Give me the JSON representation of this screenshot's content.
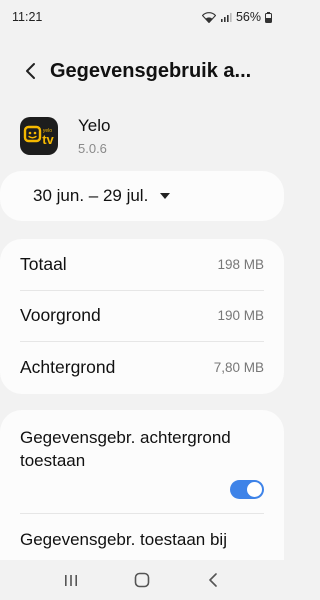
{
  "status": {
    "time": "11:21",
    "battery": "56%"
  },
  "header": {
    "title": "Gegevensgebruik a..."
  },
  "app": {
    "name": "Yelo",
    "version": "5.0.6",
    "icon_text": "tv",
    "icon_small_text": "yelo"
  },
  "date_range": {
    "label": "30 jun. – 29 jul."
  },
  "usage": {
    "rows": [
      {
        "label": "Totaal",
        "value": "198 MB"
      },
      {
        "label": "Voorgrond",
        "value": "190 MB"
      },
      {
        "label": "Achtergrond",
        "value": "7,80 MB"
      }
    ]
  },
  "settings": {
    "background_data_label": "Gegevensgebr. achtergrond toestaan",
    "background_data_enabled": true,
    "datasaver_label": "Gegevensgebr. toestaan bij"
  },
  "colors": {
    "accent": "#3e83e8",
    "app_icon_bg": "#1d1d1d",
    "app_icon_fg": "#f5b800"
  }
}
